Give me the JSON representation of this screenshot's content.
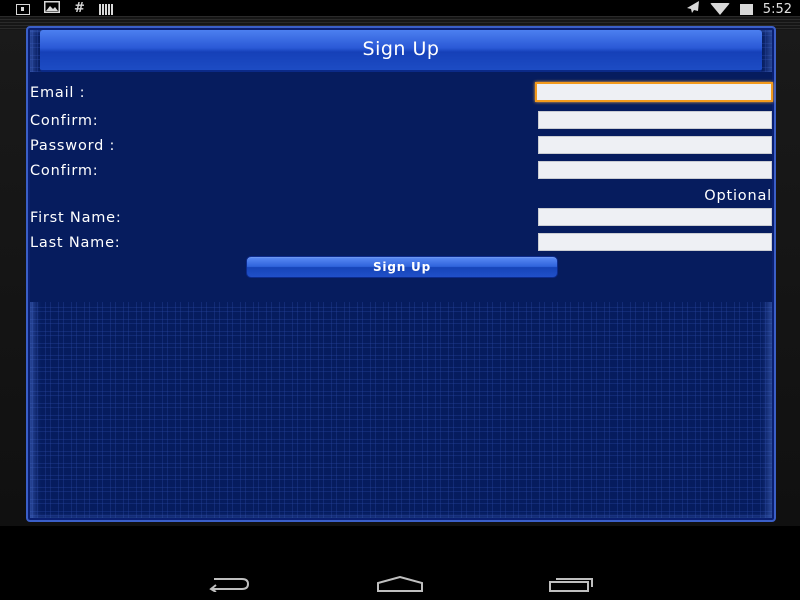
{
  "status_bar": {
    "left_icons": [
      "download-icon",
      "image-icon",
      "hash-icon",
      "signal-bars-icon"
    ],
    "right_icons": [
      "airplane-icon",
      "wifi-icon",
      "battery-icon"
    ],
    "clock": "5:52"
  },
  "form": {
    "title": "Sign Up",
    "email_label": "Email :",
    "email_value": "",
    "confirm_email_label": "Confirm:",
    "password_label": "Password :",
    "confirm_password_label": "Confirm:",
    "optional_label": "Optional",
    "first_name_label": "First Name:",
    "last_name_label": "Last Name:",
    "submit_label": "Sign Up"
  },
  "nav_bar": {
    "buttons": [
      "back-icon",
      "home-icon",
      "recent-apps-icon"
    ]
  },
  "colors": {
    "panel_bg": "#061c5e",
    "title_bar": "#2a59d6",
    "focus_border": "#f39a1c",
    "field_bg": "#eef0f4"
  }
}
